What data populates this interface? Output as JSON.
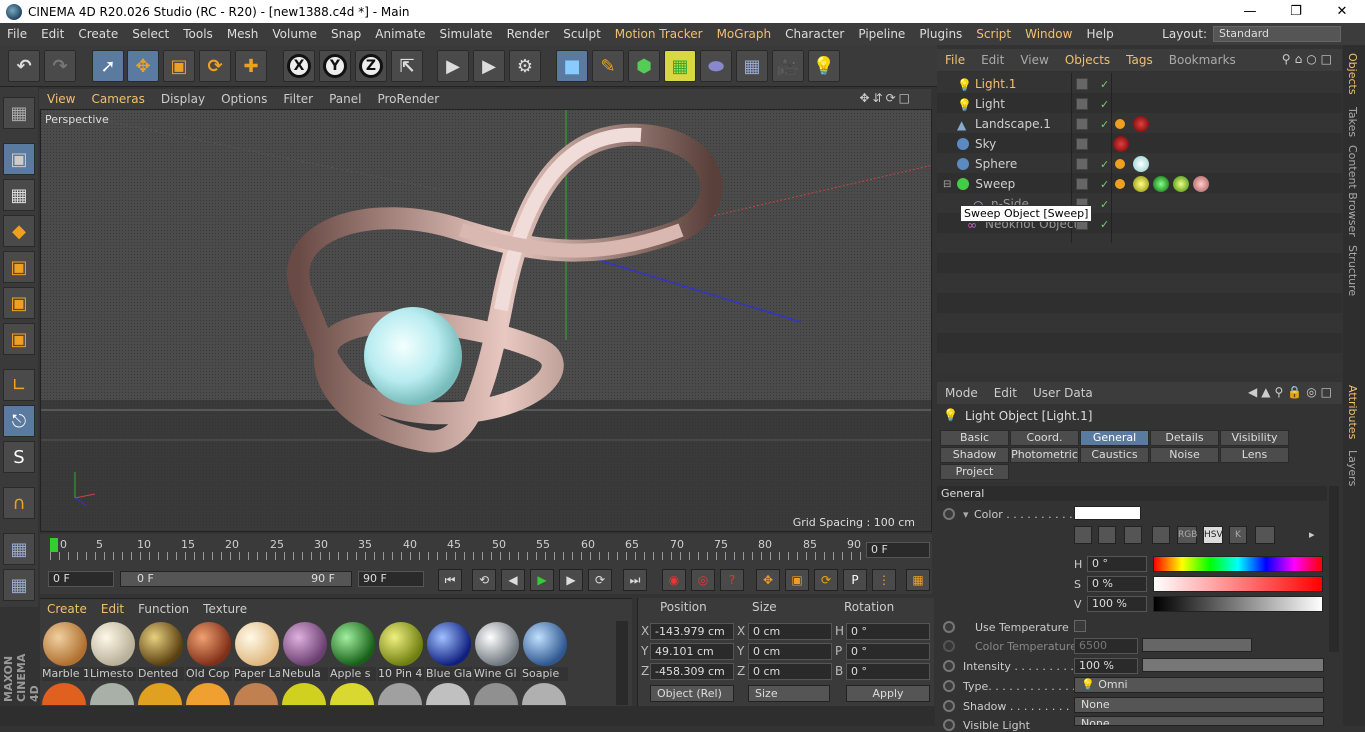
{
  "window": {
    "title": "CINEMA 4D R20.026 Studio (RC - R20) - [new1388.c4d *] - Main"
  },
  "menubar": {
    "items": [
      "File",
      "Edit",
      "Create",
      "Select",
      "Tools",
      "Mesh",
      "Volume",
      "Snap",
      "Animate",
      "Simulate",
      "Render",
      "Sculpt",
      "Motion Tracker",
      "MoGraph",
      "Character",
      "Pipeline",
      "Plugins",
      "Script",
      "Window",
      "Help"
    ],
    "layout_label": "Layout:",
    "layout_value": "Standard"
  },
  "viewport": {
    "menu": [
      "View",
      "Cameras",
      "Display",
      "Options",
      "Filter",
      "Panel",
      "ProRender"
    ],
    "label": "Perspective",
    "grid_spacing": "Grid Spacing : 100 cm"
  },
  "timeline": {
    "ticks": [
      "0",
      "5",
      "10",
      "15",
      "20",
      "25",
      "30",
      "35",
      "40",
      "45",
      "50",
      "55",
      "60",
      "65",
      "70",
      "75",
      "80",
      "85",
      "90"
    ],
    "current_frame": "0 F",
    "start": "0 F",
    "range_start": "0 F",
    "range_end": "90 F",
    "end": "90 F"
  },
  "materials": {
    "menu": [
      "Create",
      "Edit",
      "Function",
      "Texture"
    ],
    "items": [
      {
        "name": "Marble",
        "color": "#c89050"
      },
      {
        "name": "Limestone",
        "color": "#e0d8c0"
      },
      {
        "name": "Dented",
        "color": "#8a7030"
      },
      {
        "name": "Old Copper",
        "color": "#b05a30"
      },
      {
        "name": "Paper Lamp",
        "color": "#f0d8a8"
      },
      {
        "name": "Nebula",
        "color": "#9a70a0"
      },
      {
        "name": "Apple Seed",
        "color": "#40a040"
      },
      {
        "name": "10 Pin",
        "color": "#a0b020"
      },
      {
        "name": "Blue Glass",
        "color": "#3050c0"
      },
      {
        "name": "Wine Glass",
        "color": "#a0a8b0"
      },
      {
        "name": "Soapie",
        "color": "#6090c0"
      }
    ],
    "labels": [
      "Marble 1",
      "Limesto",
      "Dented",
      "Old Cop",
      "Paper La",
      "Nebula",
      "Apple s",
      "10 Pin 4",
      "Blue Gla",
      "Wine Gl",
      "Soapie"
    ]
  },
  "coordinates": {
    "headers": [
      "Position",
      "Size",
      "Rotation"
    ],
    "rows": [
      {
        "axis": "X",
        "pos": "-143.979 cm",
        "saxis": "X",
        "size": "0 cm",
        "raxis": "H",
        "rot": "0 °"
      },
      {
        "axis": "Y",
        "pos": "49.101 cm",
        "saxis": "Y",
        "size": "0 cm",
        "raxis": "P",
        "rot": "0 °"
      },
      {
        "axis": "Z",
        "pos": "-458.309 cm",
        "saxis": "Z",
        "size": "0 cm",
        "raxis": "B",
        "rot": "0 °"
      }
    ],
    "mode": "Object (Rel)",
    "size_mode": "Size",
    "apply": "Apply"
  },
  "objects": {
    "menu": [
      "File",
      "Edit",
      "View",
      "Objects",
      "Tags",
      "Bookmarks"
    ],
    "items": [
      {
        "name": "Light.1",
        "selected": true
      },
      {
        "name": "Light"
      },
      {
        "name": "Landscape.1"
      },
      {
        "name": "Sky"
      },
      {
        "name": "Sphere"
      },
      {
        "name": "Sweep"
      },
      {
        "name": "n-Side"
      },
      {
        "name": "Neoknot Object"
      }
    ],
    "tooltip": "Sweep Object [Sweep]"
  },
  "attributes": {
    "menu": [
      "Mode",
      "Edit",
      "User Data"
    ],
    "object_title": "Light Object [Light.1]",
    "tabs": [
      "Basic",
      "Coord.",
      "General",
      "Details",
      "Visibility",
      "Shadow",
      "Photometric",
      "Caustics",
      "Noise",
      "Lens",
      "Project"
    ],
    "active_tab": "General",
    "section": "General",
    "color_label": "Color . . . . . . . . . .",
    "color_modes": [
      "RGB",
      "HSV",
      "K"
    ],
    "h_label": "H",
    "h_value": "0 °",
    "s_label": "S",
    "s_value": "0 %",
    "v_label": "V",
    "v_value": "100 %",
    "use_temp": "Use Temperature",
    "color_temp": "Color Temperature",
    "color_temp_value": "6500",
    "intensity_label": "Intensity . . . . . . . . . .",
    "intensity_value": "100 %",
    "type_label": "Type. . . . . . . . . . . . . .",
    "type_value": "Omni",
    "shadow_label": "Shadow . . . . . . . . . . .",
    "shadow_value": "None",
    "visible_light_label": "Visible Light",
    "visible_light_value": "None"
  },
  "right_tabs": [
    "Objects",
    "Takes",
    "Content Browser",
    "Structure",
    "Attributes",
    "Layers"
  ]
}
